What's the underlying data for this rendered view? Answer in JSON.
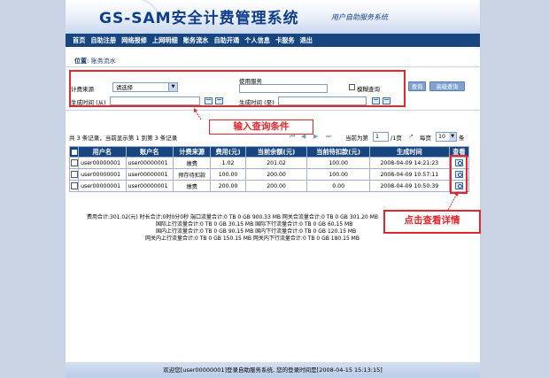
{
  "header": {
    "title": "GS-SAM安全计费管理系统",
    "subtitle": "用户自助服务系统"
  },
  "nav": [
    "首页",
    "自助注册",
    "网络报修",
    "上网明细",
    "账务流水",
    "自助开通",
    "个人信息",
    "卡服务",
    "退出"
  ],
  "breadcrumb": {
    "label": "位置",
    "value": "账务流水"
  },
  "query": {
    "fee_source_label": "计费来源",
    "fee_source_value": "请选择",
    "service_label": "使用服务",
    "service_value": "",
    "fuzzy_label": "模糊查询",
    "time_from_label": "生成时间 (从)",
    "time_from_value": "",
    "time_to_label": "生成时间 (至)",
    "time_to_value": "",
    "query_button": "查询",
    "advanced_button": "高级查询"
  },
  "callout_query": "输入查询条件",
  "callout_detail": "点击查看详情",
  "pager": {
    "summary": "共 3 条记录，当前显示第 1 到第 3 条记录",
    "current_label": "当前为第",
    "current_page": "1",
    "page_of": "/1页",
    "per_page_label": "每页",
    "per_page_value": "10",
    "per_page_unit": "条"
  },
  "table": {
    "headers": [
      "用户名",
      "账户名",
      "计费来源",
      "费用(元)",
      "当前余额(元)",
      "当前待扣款(元)",
      "生成时间",
      "查看"
    ],
    "rows": [
      [
        "user00000001",
        "user00000001",
        "缴费",
        "1.02",
        "201.02",
        "100.00",
        "2008-04-09 14:21:23"
      ],
      [
        "user00000001",
        "user00000001",
        "预存待扣款",
        "100.00",
        "200.00",
        "100.00",
        "2008-04-09 10:57:11"
      ],
      [
        "user00000001",
        "user00000001",
        "缴费",
        "200.00",
        "200.00",
        "0.00",
        "2008-04-09 10:50:39"
      ]
    ]
  },
  "summary": {
    "line1": "费用合计:301.02(元)    时长合计:0时0分0秒    端口流量合计:0 TB 0 GB 900.33 MB    网关合流量合计:0 TB 0 GB 301.20 MB",
    "line2": "国际上行流量合计:0 TB 0 GB 30.15 MB    国际下行流量合计:0 TB 0 GB 60.15 MB",
    "line3": "国内上行流量合计:0 TB 0 GB 90.15 MB    国内下行流量合计:0 TB 0 GB 120.15 MB",
    "line4": "网关内上行流量合计:0 TB 0 GB 150.15 MB    网关内下行流量合计:0 TB 0 GB 180.15 MB"
  },
  "footer": "欢迎您[user00000001]登录自助服务系统, 您的登录时间是[2008-04-15 15:13:15]"
}
